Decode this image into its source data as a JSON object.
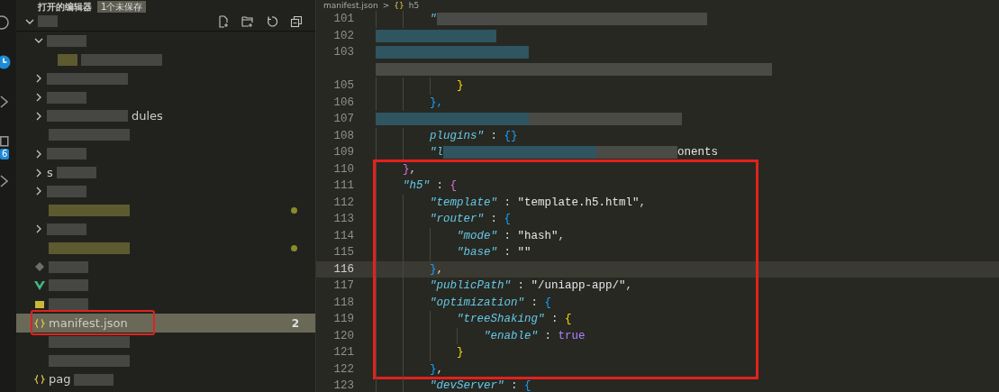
{
  "activity_bar": {
    "items": [
      {
        "kind": "circle"
      },
      {
        "kind": "clock"
      },
      {
        "kind": "chevron"
      },
      {
        "kind": "square",
        "badge": "6"
      },
      {
        "kind": "chevron"
      }
    ]
  },
  "sidebar": {
    "header": {
      "title": "打开的编辑器",
      "badge": "1个未保存"
    },
    "root": {
      "kind": "folder",
      "expanded": true,
      "selected": false,
      "parts": [
        {
          "kind": "blur_xs"
        }
      ],
      "children": [
        {
          "kind": "folder",
          "expanded": true,
          "selected": false,
          "parts": [
            {
              "kind": "blur_s"
            }
          ],
          "children": [
            {
              "kind": "file",
              "selected": false,
              "parts": [
                {
                  "kind": "smudge_xs"
                },
                {
                  "kind": "blur_m"
                }
              ]
            }
          ]
        },
        {
          "kind": "folder",
          "expanded": false,
          "selected": false,
          "parts": [
            {
              "kind": "blur_m"
            }
          ]
        },
        {
          "kind": "folder",
          "expanded": false,
          "selected": false,
          "parts": [
            {
              "kind": "blur_s"
            }
          ]
        },
        {
          "kind": "folder",
          "expanded": false,
          "selected": false,
          "parts": [
            {
              "kind": "blur_m"
            },
            {
              "kind": "text",
              "text": "dules"
            }
          ]
        },
        {
          "kind": "file",
          "selected": false,
          "parts": [
            {
              "kind": "blur_m"
            }
          ]
        },
        {
          "kind": "folder",
          "expanded": false,
          "selected": false,
          "parts": [
            {
              "kind": "blur_s"
            }
          ]
        },
        {
          "kind": "folder",
          "expanded": false,
          "selected": false,
          "parts": [
            {
              "kind": "text",
              "text": "s"
            },
            {
              "kind": "blur_s"
            }
          ]
        },
        {
          "kind": "folder",
          "expanded": false,
          "selected": false,
          "parts": [
            {
              "kind": "blur_s"
            }
          ]
        },
        {
          "kind": "file",
          "selected": false,
          "modified": true,
          "parts": [
            {
              "kind": "smudge_m"
            }
          ]
        },
        {
          "kind": "folder",
          "expanded": false,
          "selected": false,
          "parts": [
            {
              "kind": "blur_s"
            }
          ]
        },
        {
          "kind": "file",
          "selected": false,
          "modified": true,
          "parts": [
            {
              "kind": "smudge_m"
            }
          ]
        },
        {
          "kind": "git",
          "selected": false,
          "parts": [
            {
              "kind": "blur_s"
            }
          ]
        },
        {
          "kind": "vue",
          "selected": false,
          "parts": [
            {
              "kind": "blur_s"
            }
          ]
        },
        {
          "kind": "js",
          "selected": false,
          "parts": [
            {
              "kind": "blur_s"
            }
          ]
        },
        {
          "kind": "json",
          "selected": true,
          "highlighted": true,
          "badge": "2",
          "parts": [
            {
              "kind": "text",
              "text": "manifest.json"
            }
          ]
        },
        {
          "kind": "file",
          "selected": false,
          "parts": [
            {
              "kind": "blur_m"
            }
          ]
        },
        {
          "kind": "file",
          "selected": false,
          "parts": [
            {
              "kind": "blur_m"
            }
          ]
        },
        {
          "kind": "json",
          "selected": false,
          "parts": [
            {
              "kind": "text",
              "text": "pag"
            },
            {
              "kind": "blur_s"
            }
          ]
        }
      ]
    }
  },
  "editor": {
    "breadcrumb": [
      {
        "kind": "file",
        "text": "manifest.json"
      },
      {
        "kind": "sep",
        "text": ">"
      },
      {
        "kind": "icon",
        "text": "{}"
      },
      {
        "kind": "text",
        "text": "h5"
      }
    ],
    "lines": [
      {
        "number": "101",
        "current": false,
        "highlighted": false,
        "tokens": [
          {
            "kind": "key",
            "text": "        \""
          },
          {
            "kind": "smudge_xl"
          }
        ]
      },
      {
        "number": "102",
        "current": false,
        "highlighted": false,
        "tokens": [
          {
            "kind": "blur_m"
          },
          {
            "kind": "blur_s"
          }
        ]
      },
      {
        "number": "103",
        "current": false,
        "highlighted": false,
        "tokens": [
          {
            "kind": "blur_l"
          }
        ]
      },
      {
        "current": false,
        "highlighted": false,
        "tokens": [
          {
            "kind": "smudge_xxl"
          }
        ]
      },
      {
        "number": "105",
        "current": false,
        "highlighted": false,
        "tokens": [
          {
            "kind": "brace",
            "text": "            }",
            "color": "#ffd700"
          }
        ]
      },
      {
        "number": "106",
        "current": false,
        "highlighted": false,
        "tokens": [
          {
            "kind": "brace",
            "text": "        },",
            "color": "#179fff"
          }
        ]
      },
      {
        "number": "107",
        "current": false,
        "highlighted": false,
        "tokens": [
          {
            "kind": "blur_l"
          },
          {
            "kind": "smudge_l"
          }
        ]
      },
      {
        "number": "108",
        "current": false,
        "highlighted": false,
        "tokens": [
          {
            "kind": "key",
            "text": "        plugins\""
          },
          {
            "kind": "punct",
            "text": " : "
          },
          {
            "kind": "brace",
            "text": "{}",
            "color": "#179fff"
          }
        ]
      },
      {
        "number": "109",
        "current": false,
        "highlighted": false,
        "tokens": [
          {
            "kind": "key",
            "text": "        \"l"
          },
          {
            "kind": "blur_l"
          },
          {
            "kind": "smudge_m"
          },
          {
            "kind": "string",
            "text": "onents"
          }
        ]
      },
      {
        "number": "110",
        "current": false,
        "highlighted": true,
        "tokens": [
          {
            "kind": "brace",
            "text": "    }",
            "color": "#da70d6"
          },
          {
            "kind": "punct",
            "text": ","
          }
        ]
      },
      {
        "number": "111",
        "current": false,
        "highlighted": true,
        "tokens": [
          {
            "kind": "key",
            "text": "    \"h5\""
          },
          {
            "kind": "punct",
            "text": " : "
          },
          {
            "kind": "brace",
            "text": "{",
            "color": "#da70d6"
          }
        ]
      },
      {
        "number": "112",
        "current": false,
        "highlighted": true,
        "tokens": [
          {
            "kind": "key",
            "text": "        \"template\""
          },
          {
            "kind": "punct",
            "text": " : "
          },
          {
            "kind": "string",
            "text": "\"template.h5.html\""
          },
          {
            "kind": "punct",
            "text": ","
          }
        ]
      },
      {
        "number": "113",
        "current": false,
        "highlighted": true,
        "tokens": [
          {
            "kind": "key",
            "text": "        \"router\""
          },
          {
            "kind": "punct",
            "text": " : "
          },
          {
            "kind": "brace",
            "text": "{",
            "color": "#179fff"
          }
        ]
      },
      {
        "number": "114",
        "current": false,
        "highlighted": true,
        "tokens": [
          {
            "kind": "key",
            "text": "            \"mode\""
          },
          {
            "kind": "punct",
            "text": " : "
          },
          {
            "kind": "string",
            "text": "\"hash\""
          },
          {
            "kind": "punct",
            "text": ","
          }
        ]
      },
      {
        "number": "115",
        "current": false,
        "highlighted": true,
        "tokens": [
          {
            "kind": "key",
            "text": "            \"base\""
          },
          {
            "kind": "punct",
            "text": " : "
          },
          {
            "kind": "string",
            "text": "\"\""
          }
        ]
      },
      {
        "number": "116",
        "current": true,
        "highlighted": true,
        "tokens": [
          {
            "kind": "brace",
            "text": "        }",
            "color": "#179fff"
          },
          {
            "kind": "punct",
            "text": ","
          }
        ]
      },
      {
        "number": "117",
        "current": false,
        "highlighted": true,
        "tokens": [
          {
            "kind": "key",
            "text": "        \"publicPath\""
          },
          {
            "kind": "punct",
            "text": " : "
          },
          {
            "kind": "string",
            "text": "\"/uniapp-app/\""
          },
          {
            "kind": "punct",
            "text": ","
          }
        ]
      },
      {
        "number": "118",
        "current": false,
        "highlighted": true,
        "tokens": [
          {
            "kind": "key",
            "text": "        \"optimization\""
          },
          {
            "kind": "punct",
            "text": " : "
          },
          {
            "kind": "brace",
            "text": "{",
            "color": "#179fff"
          }
        ]
      },
      {
        "number": "119",
        "current": false,
        "highlighted": true,
        "tokens": [
          {
            "kind": "key",
            "text": "            \"treeShaking\""
          },
          {
            "kind": "punct",
            "text": " : "
          },
          {
            "kind": "brace",
            "text": "{",
            "color": "#ffd700"
          }
        ]
      },
      {
        "number": "120",
        "current": false,
        "highlighted": true,
        "tokens": [
          {
            "kind": "key",
            "text": "                \"enable\""
          },
          {
            "kind": "punct",
            "text": " : "
          },
          {
            "kind": "bool",
            "text": "true"
          }
        ]
      },
      {
        "number": "121",
        "current": false,
        "highlighted": true,
        "tokens": [
          {
            "kind": "brace",
            "text": "            }",
            "color": "#ffd700"
          }
        ]
      },
      {
        "number": "122",
        "current": false,
        "highlighted": true,
        "tokens": [
          {
            "kind": "brace",
            "text": "        }",
            "color": "#179fff"
          },
          {
            "kind": "punct",
            "text": ","
          }
        ]
      },
      {
        "number": "123",
        "current": false,
        "highlighted": false,
        "tokens": [
          {
            "kind": "key",
            "text": "        \"devServer\""
          },
          {
            "kind": "punct",
            "text": " : "
          },
          {
            "kind": "brace",
            "text": "{",
            "color": "#179fff"
          }
        ]
      }
    ]
  }
}
